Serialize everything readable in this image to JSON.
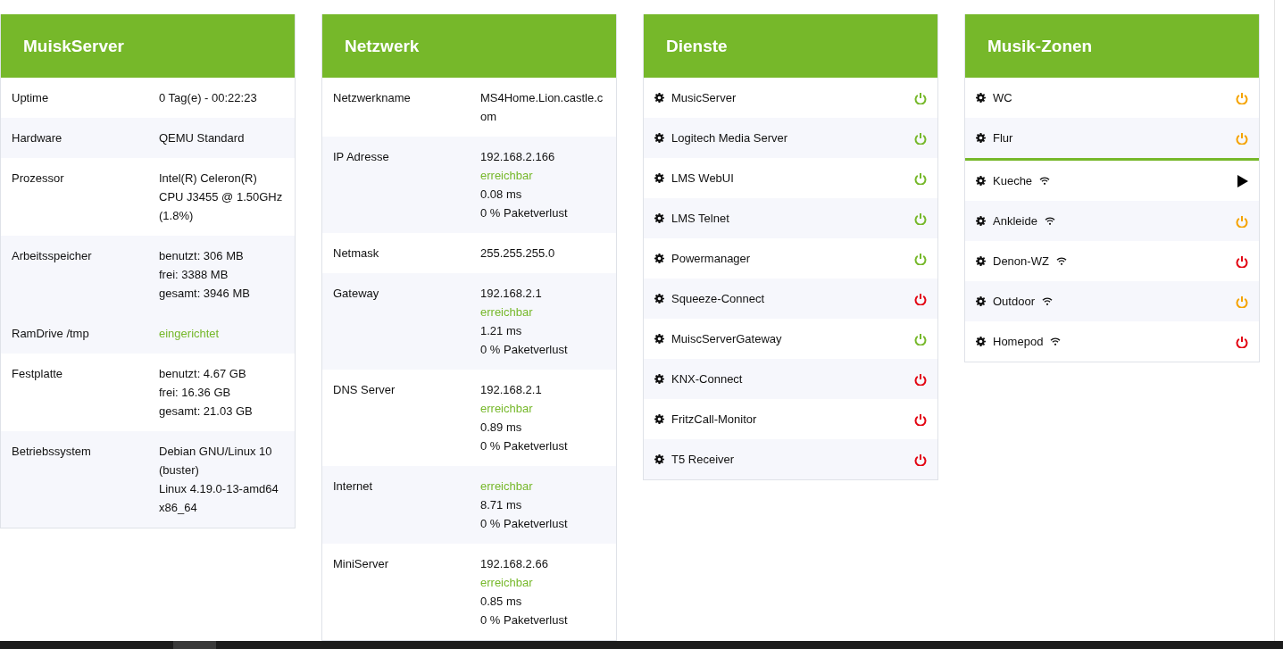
{
  "panels": [
    {
      "kind": "info",
      "title": "MuiskServer",
      "groups": [
        {
          "rows": [
            {
              "label": "Uptime",
              "lines": [
                {
                  "text": "0 Tag(e) - 00:22:23",
                  "kind": "plain"
                }
              ]
            }
          ]
        },
        {
          "rows": [
            {
              "label": "Hardware",
              "lines": [
                {
                  "text": "QEMU Standard",
                  "kind": "plain"
                }
              ]
            }
          ]
        },
        {
          "rows": [
            {
              "label": "Prozessor",
              "lines": [
                {
                  "text": "Intel(R) Celeron(R) CPU J3455 @ 1.50GHz",
                  "kind": "plain"
                },
                {
                  "text": "(1.8%)",
                  "kind": "plain"
                }
              ]
            }
          ]
        },
        {
          "rows": [
            {
              "label": "Arbeitsspeicher",
              "lines": [
                {
                  "text": "benutzt: 306 MB",
                  "kind": "plain"
                },
                {
                  "text": "frei: 3388 MB",
                  "kind": "plain"
                },
                {
                  "text": "gesamt: 3946 MB",
                  "kind": "plain"
                }
              ]
            },
            {
              "label": "RamDrive /tmp",
              "lines": [
                {
                  "text": "eingerichtet",
                  "kind": "ok"
                }
              ]
            }
          ]
        },
        {
          "rows": [
            {
              "label": "Festplatte",
              "lines": [
                {
                  "text": "benutzt: 4.67 GB",
                  "kind": "plain"
                },
                {
                  "text": "frei: 16.36 GB",
                  "kind": "plain"
                },
                {
                  "text": "gesamt: 21.03 GB",
                  "kind": "plain"
                }
              ]
            }
          ]
        },
        {
          "rows": [
            {
              "label": "Betriebssystem",
              "lines": [
                {
                  "text": "Debian GNU/Linux 10 (buster)",
                  "kind": "plain"
                },
                {
                  "text": "Linux 4.19.0-13-amd64 x86_64",
                  "kind": "plain"
                }
              ]
            }
          ]
        }
      ]
    },
    {
      "kind": "info",
      "title": "Netzwerk",
      "groups": [
        {
          "rows": [
            {
              "label": "Netzwerkname",
              "lines": [
                {
                  "text": "MS4Home.Lion.castle.com",
                  "kind": "plain"
                }
              ]
            }
          ]
        },
        {
          "rows": [
            {
              "label": "IP Adresse",
              "lines": [
                {
                  "text": "192.168.2.166",
                  "kind": "plain"
                },
                {
                  "text": "erreichbar",
                  "kind": "ok"
                },
                {
                  "text": "0.08 ms",
                  "kind": "plain"
                },
                {
                  "text": "0 % Paketverlust",
                  "kind": "plain"
                }
              ]
            }
          ]
        },
        {
          "rows": [
            {
              "label": "Netmask",
              "lines": [
                {
                  "text": "255.255.255.0",
                  "kind": "plain"
                }
              ]
            }
          ]
        },
        {
          "rows": [
            {
              "label": "Gateway",
              "lines": [
                {
                  "text": "192.168.2.1",
                  "kind": "plain"
                },
                {
                  "text": "erreichbar",
                  "kind": "ok"
                },
                {
                  "text": "1.21 ms",
                  "kind": "plain"
                },
                {
                  "text": "0 % Paketverlust",
                  "kind": "plain"
                }
              ]
            }
          ]
        },
        {
          "rows": [
            {
              "label": "DNS Server",
              "lines": [
                {
                  "text": "192.168.2.1",
                  "kind": "plain"
                },
                {
                  "text": "erreichbar",
                  "kind": "ok"
                },
                {
                  "text": "0.89 ms",
                  "kind": "plain"
                },
                {
                  "text": "0 % Paketverlust",
                  "kind": "plain"
                }
              ]
            }
          ]
        },
        {
          "rows": [
            {
              "label": "Internet",
              "lines": [
                {
                  "text": "erreichbar",
                  "kind": "ok"
                },
                {
                  "text": "8.71 ms",
                  "kind": "plain"
                },
                {
                  "text": "0 % Paketverlust",
                  "kind": "plain"
                }
              ]
            }
          ]
        },
        {
          "rows": [
            {
              "label": "MiniServer",
              "lines": [
                {
                  "text": "192.168.2.66",
                  "kind": "plain"
                },
                {
                  "text": "erreichbar",
                  "kind": "ok"
                },
                {
                  "text": "0.85 ms",
                  "kind": "plain"
                },
                {
                  "text": "0 % Paketverlust",
                  "kind": "plain"
                }
              ]
            }
          ]
        }
      ]
    },
    {
      "kind": "services",
      "title": "Dienste",
      "items": [
        {
          "name": "MusicServer",
          "kind": "power",
          "color": "#76b82a"
        },
        {
          "name": "Logitech Media Server",
          "kind": "power",
          "color": "#76b82a"
        },
        {
          "name": "LMS WebUI",
          "kind": "power",
          "color": "#76b82a"
        },
        {
          "name": "LMS Telnet",
          "kind": "power",
          "color": "#76b82a"
        },
        {
          "name": "Powermanager",
          "kind": "power",
          "color": "#76b82a"
        },
        {
          "name": "Squeeze-Connect",
          "kind": "power",
          "color": "#e30613"
        },
        {
          "name": "MuiscServerGateway",
          "kind": "power",
          "color": "#76b82a"
        },
        {
          "name": "KNX-Connect",
          "kind": "power",
          "color": "#e30613"
        },
        {
          "name": "FritzCall-Monitor",
          "kind": "power",
          "color": "#e30613"
        },
        {
          "name": "T5 Receiver",
          "kind": "power",
          "color": "#e30613"
        }
      ]
    },
    {
      "kind": "zones",
      "title": "Musik-Zonen",
      "groups": [
        {
          "items": [
            {
              "name": "WC",
              "wifi": false,
              "kind": "power",
              "color": "#f5a300"
            },
            {
              "name": "Flur",
              "wifi": false,
              "kind": "power",
              "color": "#f5a300"
            }
          ]
        },
        {
          "items": [
            {
              "name": "Kueche",
              "wifi": true,
              "kind": "play"
            },
            {
              "name": "Ankleide",
              "wifi": true,
              "kind": "power",
              "color": "#f5a300"
            },
            {
              "name": "Denon-WZ",
              "wifi": true,
              "kind": "power",
              "color": "#e30613"
            },
            {
              "name": "Outdoor",
              "wifi": true,
              "kind": "power",
              "color": "#f5a300"
            },
            {
              "name": "Homepod",
              "wifi": true,
              "kind": "power",
              "color": "#e30613"
            }
          ]
        }
      ]
    }
  ]
}
